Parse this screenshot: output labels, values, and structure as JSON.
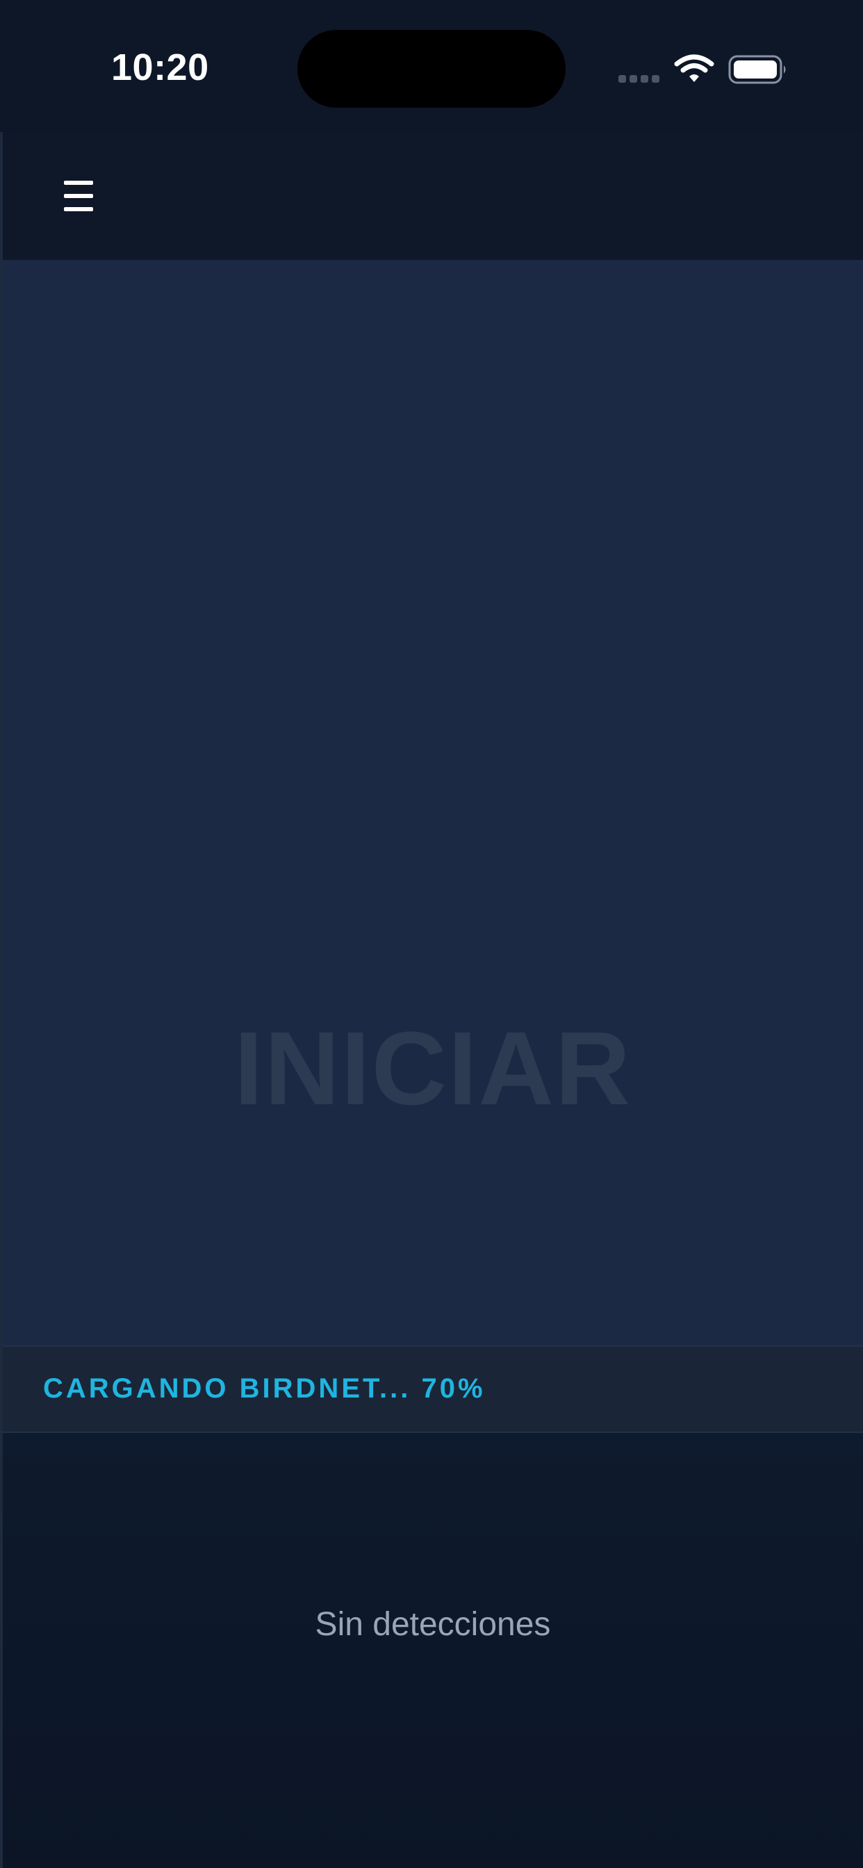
{
  "status_bar": {
    "time": "10:20",
    "icons": [
      "signal-icon",
      "wifi-icon",
      "battery-icon"
    ]
  },
  "header": {
    "menu_icon": "hamburger-menu-icon"
  },
  "start": {
    "label": "INICIAR"
  },
  "loading": {
    "text": "CARGANDO BIRDNET... 70%",
    "progress_percent": 70
  },
  "detections": {
    "empty_message": "Sin detecciones"
  },
  "colors": {
    "background": "#0c1627",
    "start_area": "#1b2944",
    "start_label": "#2c3a52",
    "accent": "#1fb5e0",
    "muted_text": "#9aa5b5"
  }
}
